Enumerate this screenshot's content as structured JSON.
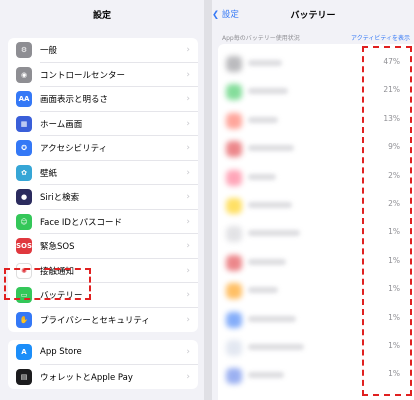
{
  "settings": {
    "title": "設定",
    "group1": [
      {
        "label": "一般",
        "icon": "gear-icon",
        "color": "#8e8e93",
        "glyph": "⚙"
      },
      {
        "label": "コントロールセンター",
        "icon": "control-center-icon",
        "color": "#8e8e93",
        "glyph": "◉"
      },
      {
        "label": "画面表示と明るさ",
        "icon": "display-brightness-icon",
        "color": "#3478f6",
        "glyph": "AA"
      },
      {
        "label": "ホーム画面",
        "icon": "home-screen-icon",
        "color": "#3a5fd9",
        "glyph": "▦"
      },
      {
        "label": "アクセシビリティ",
        "icon": "accessibility-icon",
        "color": "#3478f6",
        "glyph": "✪"
      },
      {
        "label": "壁紙",
        "icon": "wallpaper-icon",
        "color": "#36a6d6",
        "glyph": "✿"
      },
      {
        "label": "Siriと検索",
        "icon": "siri-icon",
        "color": "#2b2b5e",
        "glyph": "●"
      },
      {
        "label": "Face IDとパスコード",
        "icon": "face-id-icon",
        "color": "#34c759",
        "glyph": "☺"
      },
      {
        "label": "緊急SOS",
        "icon": "sos-icon",
        "color": "#e0383e",
        "glyph": "SOS"
      },
      {
        "label": "接触通知",
        "icon": "exposure-notification-icon",
        "color": "#ffffff",
        "glyph": "✺"
      },
      {
        "label": "バッテリー",
        "icon": "battery-icon",
        "color": "#34c759",
        "glyph": "▭"
      },
      {
        "label": "プライバシーとセキュリティ",
        "icon": "privacy-hand-icon",
        "color": "#3478f6",
        "glyph": "✋"
      }
    ],
    "group2": [
      {
        "label": "App Store",
        "icon": "app-store-icon",
        "color": "#1c8ef9",
        "glyph": "A"
      },
      {
        "label": "ウォレットとApple Pay",
        "icon": "wallet-icon",
        "color": "#1c1c1e",
        "glyph": "▤"
      }
    ]
  },
  "battery": {
    "back_label": "設定",
    "title": "バッテリー",
    "usage_header": "App毎のバッテリー使用状況",
    "activity_link": "アクティビティを表示",
    "apps": [
      {
        "pct": "47%",
        "color": "#8e8e93",
        "textw": 34
      },
      {
        "pct": "21%",
        "color": "#34c759",
        "textw": 40
      },
      {
        "pct": "13%",
        "color": "#ff6b5a",
        "textw": 30
      },
      {
        "pct": "9%",
        "color": "#e0383e",
        "textw": 46
      },
      {
        "pct": "2%",
        "color": "#ff6b8a",
        "textw": 28
      },
      {
        "pct": "2%",
        "color": "#ffcc00",
        "textw": 44
      },
      {
        "pct": "1%",
        "color": "#d0d0d5",
        "textw": 52
      },
      {
        "pct": "1%",
        "color": "#e0383e",
        "textw": 38
      },
      {
        "pct": "1%",
        "color": "#ff9500",
        "textw": 30
      },
      {
        "pct": "1%",
        "color": "#3478f6",
        "textw": 48
      },
      {
        "pct": "1%",
        "color": "#d0d8e8",
        "textw": 56
      },
      {
        "pct": "1%",
        "color": "#5a7de8",
        "textw": 36
      }
    ]
  }
}
